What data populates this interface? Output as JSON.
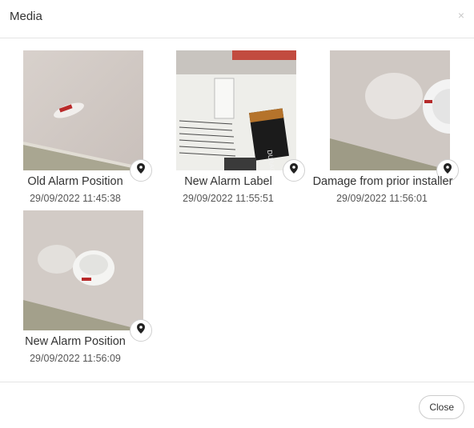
{
  "modal": {
    "title": "Media",
    "close_icon": "×",
    "close_button_label": "Close"
  },
  "media": [
    {
      "caption": "Old Alarm Position",
      "timestamp": "29/09/2022 11:45:38",
      "icon": "map-pin-icon"
    },
    {
      "caption": "New Alarm Label",
      "timestamp": "29/09/2022 11:55:51",
      "icon": "map-pin-icon"
    },
    {
      "caption": "Damage from prior installer",
      "timestamp": "29/09/2022 11:56:01",
      "icon": "map-pin-icon"
    },
    {
      "caption": "New Alarm Position",
      "timestamp": "29/09/2022 11:56:09",
      "icon": "map-pin-icon"
    }
  ],
  "photo_text": {
    "battery_brand": "DURACELL"
  }
}
